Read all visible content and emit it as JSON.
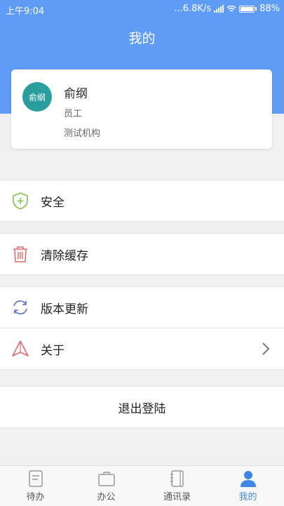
{
  "status_bar": {
    "time": "上午9:04",
    "network_speed": "...6.8K/s",
    "battery_percent": "88%",
    "battery_level": 0.88
  },
  "header": {
    "title": "我的"
  },
  "profile": {
    "avatar_text": "俞纲",
    "name": "俞纲",
    "role": "员工",
    "organization": "测试机构"
  },
  "menu": {
    "security": {
      "label": "安全",
      "icon": "shield-plus-icon"
    },
    "clear_cache": {
      "label": "清除缓存",
      "icon": "trash-icon"
    },
    "version_update": {
      "label": "版本更新",
      "icon": "refresh-icon"
    },
    "about": {
      "label": "关于",
      "icon": "navigation-arrow-icon"
    }
  },
  "logout_label": "退出登陆",
  "tabs": [
    {
      "label": "待办",
      "icon": "todo-icon",
      "active": false
    },
    {
      "label": "办公",
      "icon": "briefcase-icon",
      "active": false
    },
    {
      "label": "通讯录",
      "icon": "contacts-icon",
      "active": false
    },
    {
      "label": "我的",
      "icon": "user-icon",
      "active": true
    }
  ],
  "colors": {
    "header_blue": "#5f9cf5",
    "avatar_teal": "#2a9d9d",
    "active_tab": "#3f86e6",
    "security_green": "#7cc245",
    "cache_red": "#e06a6a",
    "update_blue": "#5b6fd6",
    "about_red": "#e06a6a"
  }
}
